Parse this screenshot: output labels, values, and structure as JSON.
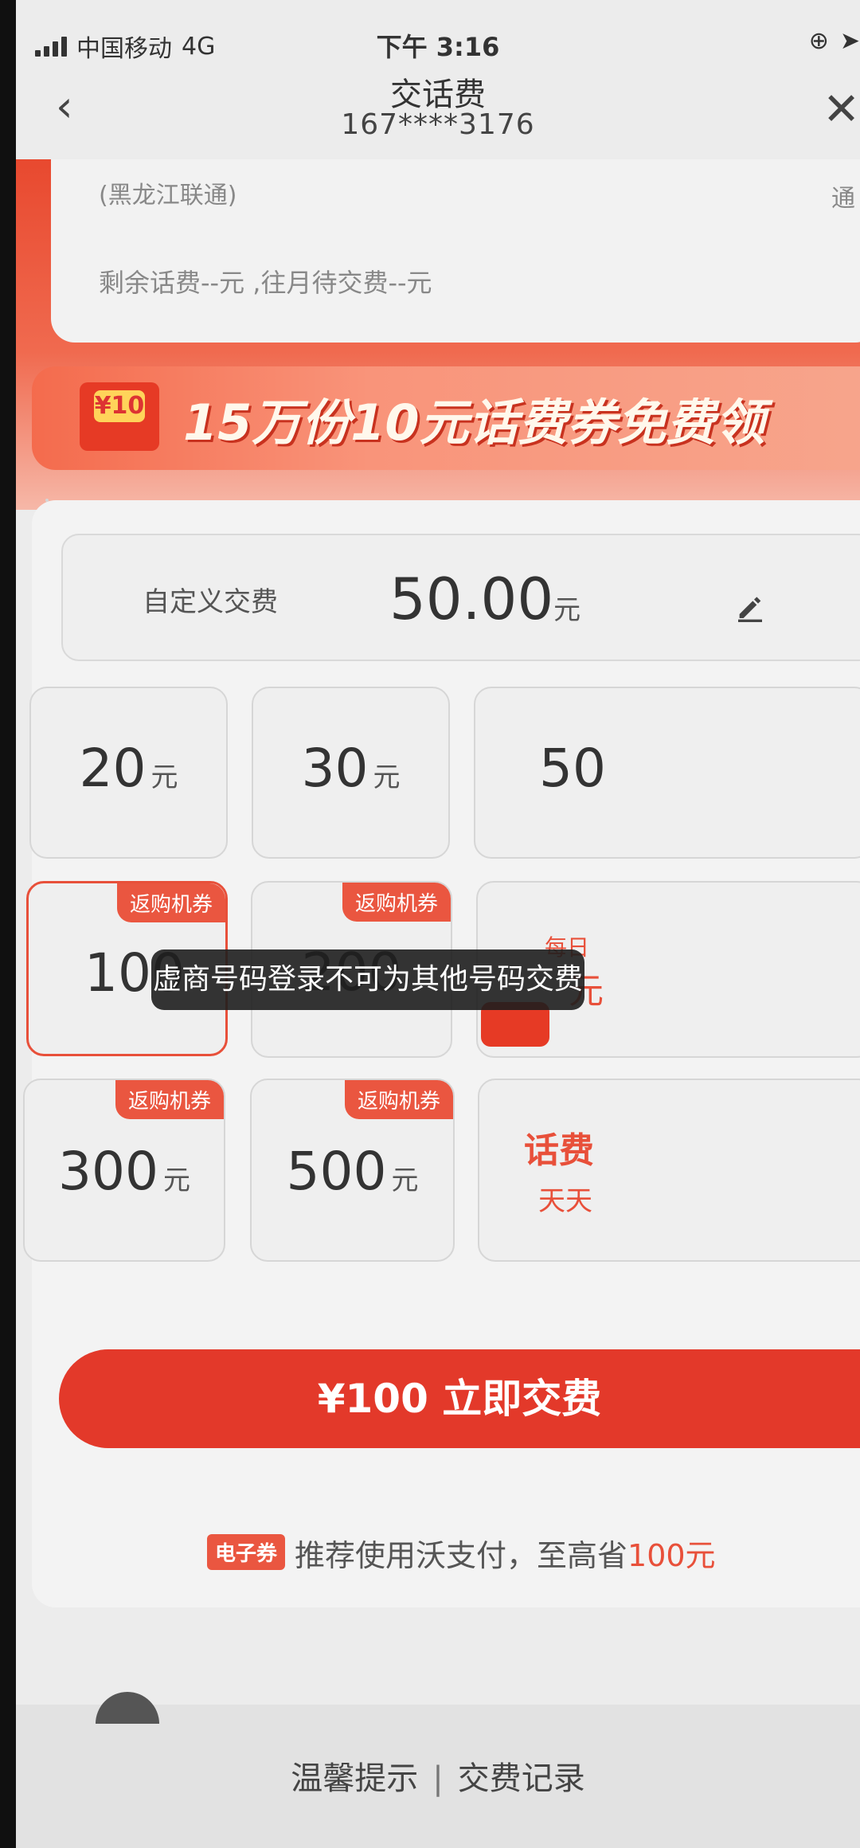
{
  "status_bar": {
    "carrier": "中国移动",
    "network": "4G",
    "time": "下午 3:16"
  },
  "nav": {
    "title": "交话费",
    "phone": "167****3176"
  },
  "account": {
    "carrier_region": "(黑龙江联通)",
    "right_hint": "通",
    "balance": "剩余话费--元 ,往月待交费--元"
  },
  "banner": {
    "coin_label": "¥10",
    "text": "15万份10元话费券免费领"
  },
  "custom_pay": {
    "label": "自定义交费",
    "amount": "50.00",
    "unit": "元"
  },
  "tiles": [
    {
      "amount": "20",
      "unit": "元",
      "badge": ""
    },
    {
      "amount": "30",
      "unit": "元",
      "badge": ""
    },
    {
      "amount": "50",
      "unit": "",
      "badge": ""
    },
    {
      "amount": "100",
      "unit": "",
      "badge": "返购机券",
      "selected": true
    },
    {
      "amount": "200",
      "unit": "",
      "badge": "返购机券"
    },
    {
      "amount": "",
      "unit": "",
      "badge": ""
    },
    {
      "amount": "300",
      "unit": "元",
      "badge": "返购机券"
    },
    {
      "amount": "500",
      "unit": "元",
      "badge": "返购机券"
    }
  ],
  "promo_tile_1": {
    "top": "每日",
    "unit": "元"
  },
  "promo_tile_2": {
    "title": "话费",
    "sub": "天天"
  },
  "pay_button": "¥100 立即交费",
  "tip": {
    "badge": "电子券",
    "text": "推荐使用沃支付，至高省",
    "highlight": "100元"
  },
  "toast": "虚商号码登录不可为其他号码交费",
  "footer": {
    "tips": "温馨提示",
    "records": "交费记录"
  }
}
